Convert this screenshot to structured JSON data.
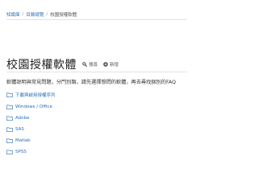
{
  "breadcrumb": {
    "items": [
      "知識庫",
      "目錄總覽",
      "校園授權軟體"
    ],
    "separator": "/"
  },
  "header": {
    "title": "校園授權軟體",
    "search_label": "搜尋",
    "new_label": "新增"
  },
  "description": "軟體說明與常見問題，分門別類，請先選擇想問的軟體，再去尋找個別的FAQ",
  "folders": [
    {
      "label": "下載與啟用授權序列"
    },
    {
      "label": "Windows / Office"
    },
    {
      "label": "Adobe"
    },
    {
      "label": "SAS"
    },
    {
      "label": "Matlab"
    },
    {
      "label": "SPSS"
    }
  ],
  "colors": {
    "link": "#2a6fb5",
    "text": "#333333",
    "divider": "#e3e3e3"
  }
}
